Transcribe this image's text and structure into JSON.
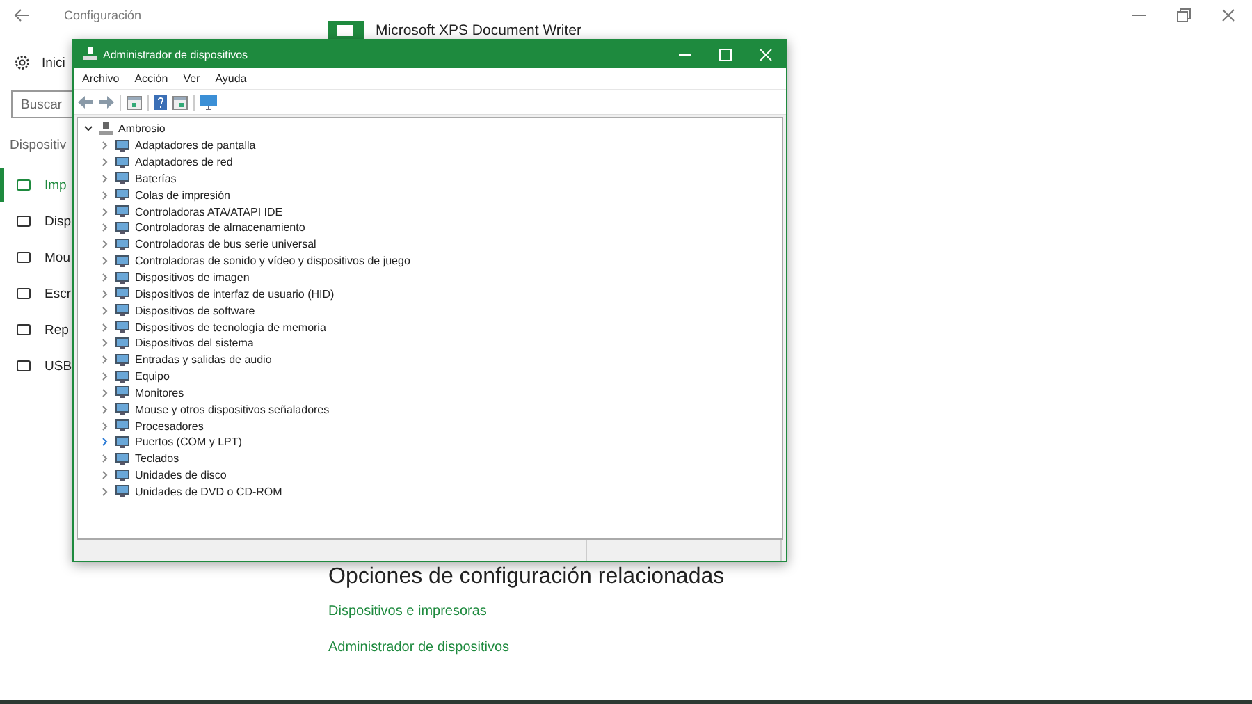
{
  "settings": {
    "title": "Configuración",
    "home": "Inici",
    "search": {
      "placeholder": "Buscar"
    },
    "section": "Dispositiv",
    "nav": [
      {
        "label": "Imp",
        "selected": true
      },
      {
        "label": "Disp",
        "selected": false
      },
      {
        "label": "Mou",
        "selected": false
      },
      {
        "label": "Escr",
        "selected": false
      },
      {
        "label": "Rep",
        "selected": false
      },
      {
        "label": "USB",
        "selected": false
      }
    ],
    "printer": "Microsoft XPS Document Writer",
    "related_heading": "Opciones de configuración relacionadas",
    "links": [
      "Dispositivos e impresoras",
      "Administrador de dispositivos"
    ]
  },
  "device_manager": {
    "title": "Administrador de dispositivos",
    "menu": [
      "Archivo",
      "Acción",
      "Ver",
      "Ayuda"
    ],
    "tree": {
      "label": "Ambrosio",
      "expanded": true,
      "children": [
        {
          "label": "Adaptadores de pantalla",
          "hovered": false
        },
        {
          "label": "Adaptadores de red",
          "hovered": false
        },
        {
          "label": "Baterías",
          "hovered": false
        },
        {
          "label": "Colas de impresión",
          "hovered": false
        },
        {
          "label": "Controladoras ATA/ATAPI IDE",
          "hovered": false
        },
        {
          "label": "Controladoras de almacenamiento",
          "hovered": false
        },
        {
          "label": "Controladoras de bus serie universal",
          "hovered": false
        },
        {
          "label": "Controladoras de sonido y vídeo y dispositivos de juego",
          "hovered": false
        },
        {
          "label": "Dispositivos de imagen",
          "hovered": false
        },
        {
          "label": "Dispositivos de interfaz de usuario (HID)",
          "hovered": false
        },
        {
          "label": "Dispositivos de software",
          "hovered": false
        },
        {
          "label": "Dispositivos de tecnología de memoria",
          "hovered": false
        },
        {
          "label": "Dispositivos del sistema",
          "hovered": false
        },
        {
          "label": "Entradas y salidas de audio",
          "hovered": false
        },
        {
          "label": "Equipo",
          "hovered": false
        },
        {
          "label": "Monitores",
          "hovered": false
        },
        {
          "label": "Mouse y otros dispositivos señaladores",
          "hovered": false
        },
        {
          "label": "Procesadores",
          "hovered": false
        },
        {
          "label": "Puertos (COM y LPT)",
          "hovered": true
        },
        {
          "label": "Teclados",
          "hovered": false
        },
        {
          "label": "Unidades de disco",
          "hovered": false
        },
        {
          "label": "Unidades de DVD o CD-ROM",
          "hovered": false
        }
      ]
    }
  }
}
